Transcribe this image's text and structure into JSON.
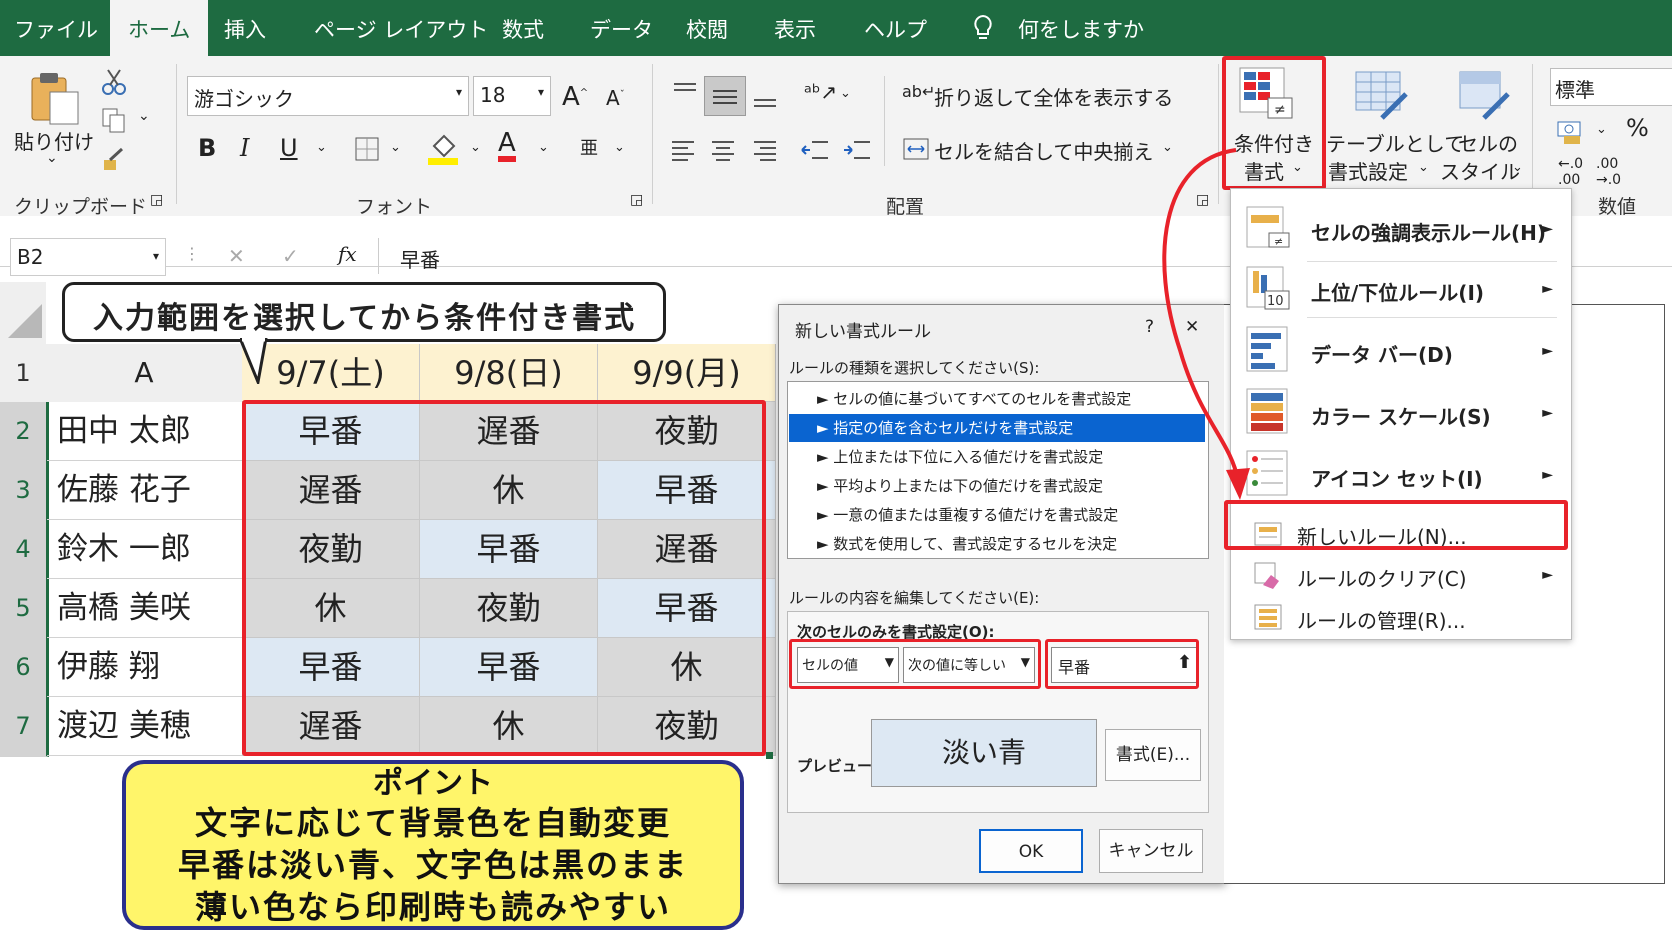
{
  "menu": {
    "tabs": [
      "ファイル",
      "ホーム",
      "挿入",
      "ページ レイアウト",
      "数式",
      "データ",
      "校閲",
      "表示",
      "ヘルプ"
    ],
    "active": "ホーム",
    "tell_me": "何をしますか"
  },
  "ribbon": {
    "clipboard": {
      "paste": "貼り付け",
      "group": "クリップボード"
    },
    "font": {
      "name": "游ゴシック",
      "size": "18",
      "bold": "B",
      "italic": "I",
      "underline": "U",
      "font_color_glyph": "A",
      "group": "フォント",
      "phonetic": "亜"
    },
    "alignment": {
      "wrap": "折り返して全体を表示する",
      "merge": "セルを結合して中央揃え",
      "group": "配置"
    },
    "styles": {
      "conditional": "条件付き",
      "conditional2": "書式",
      "table": "テーブルとして",
      "table2": "書式設定",
      "cell": "セルの",
      "cell2": "スタイル"
    },
    "number": {
      "format": "標準",
      "percent": "%",
      "group": "数値"
    }
  },
  "formula_bar": {
    "name_box": "B2",
    "fx": "fx",
    "value": "早番"
  },
  "callout": {
    "text": "入力範囲を選択してから条件付き書式"
  },
  "sheet": {
    "col_a": "A",
    "dates": [
      "9/7(土)",
      "9/8(日)",
      "9/9(月)"
    ],
    "rows": [
      {
        "num": "1"
      },
      {
        "num": "2",
        "name": "田中 太郎",
        "shifts": [
          "早番",
          "遅番",
          "夜勤"
        ]
      },
      {
        "num": "3",
        "name": "佐藤 花子",
        "shifts": [
          "遅番",
          "休",
          "早番"
        ]
      },
      {
        "num": "4",
        "name": "鈴木 一郎",
        "shifts": [
          "夜勤",
          "早番",
          "遅番"
        ]
      },
      {
        "num": "5",
        "name": "高橋 美咲",
        "shifts": [
          "休",
          "夜勤",
          "早番"
        ]
      },
      {
        "num": "6",
        "name": "伊藤 翔",
        "shifts": [
          "早番",
          "早番",
          "休"
        ]
      },
      {
        "num": "7",
        "name": "渡辺 美穂",
        "shifts": [
          "遅番",
          "休",
          "夜勤"
        ]
      }
    ],
    "colors": {
      "light_blue": "#dde8f3",
      "gray": "#d9d9d9",
      "header_fill": "#fdf2d0"
    }
  },
  "point_box": {
    "lines": [
      "ポイント",
      "文字に応じて背景色を自動変更",
      "早番は淡い青、文字色は黒のまま",
      "薄い色なら印刷時も読みやすい"
    ]
  },
  "dialog": {
    "title": "新しい書式ルール",
    "help": "?",
    "close": "✕",
    "select_label": "ルールの種類を選択してください(S):",
    "rules": [
      "► セルの値に基づいてすべてのセルを書式設定",
      "► 指定の値を含むセルだけを書式設定",
      "► 上位または下位に入る値だけを書式設定",
      "► 平均より上または下の値だけを書式設定",
      "► 一意の値または重複する値だけを書式設定",
      "► 数式を使用して、書式設定するセルを決定"
    ],
    "edit_label": "ルールの内容を編集してください(E):",
    "only_label": "次のセルのみを書式設定(O):",
    "cond1": "セルの値",
    "cond2": "次の値に等しい",
    "value": "早番",
    "preview_label": "プレビュー:",
    "preview_text": "淡い青",
    "format_button": "書式(E)...",
    "ok": "OK",
    "cancel": "キャンセル"
  },
  "cf_menu": {
    "items": [
      {
        "label": "セルの強調表示ルール(H)",
        "arrow": "►"
      },
      {
        "label": "上位/下位ルール(I)",
        "arrow": "►"
      },
      {
        "label": "データ バー(D)",
        "arrow": "►"
      },
      {
        "label": "カラー スケール(S)",
        "arrow": "►"
      },
      {
        "label": "アイコン セット(I)",
        "arrow": "►"
      },
      {
        "label": "新しいルール(N)...",
        "arrow": ""
      },
      {
        "label": "ルールのクリア(C)",
        "arrow": "►"
      },
      {
        "label": "ルールの管理(R)...",
        "arrow": ""
      }
    ],
    "icon_number": "10"
  },
  "accent": {
    "red": "#e8222a",
    "excel_green": "#1e6b41",
    "yellow": "#fff56a",
    "navy": "#2a2f8c"
  }
}
